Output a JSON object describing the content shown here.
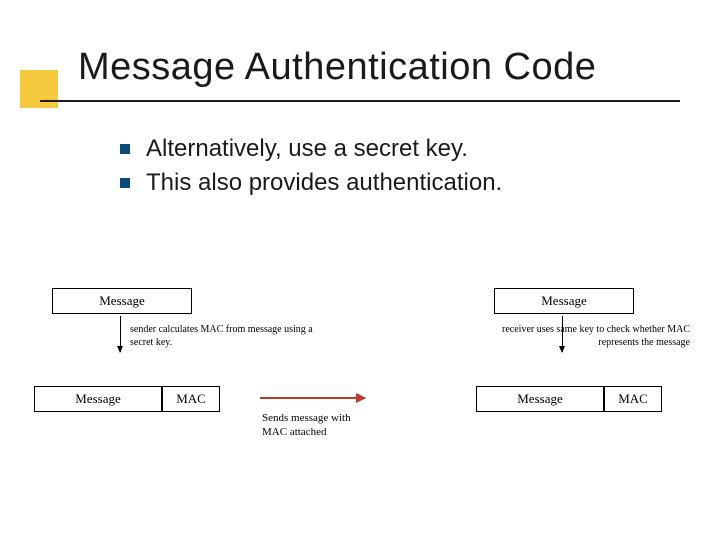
{
  "title": "Message Authentication Code",
  "bullets": [
    "Alternatively, use a secret key.",
    "This also provides authentication."
  ],
  "diagram": {
    "sender_message": "Message",
    "sender_caption": "sender calculates MAC from message using a secret key.",
    "sender_message2": "Message",
    "sender_mac": "MAC",
    "transmit_caption1": "Sends message with",
    "transmit_caption2": "MAC attached",
    "receiver_message": "Message",
    "receiver_caption": "receiver uses same key to check whether MAC represents the message",
    "receiver_message2": "Message",
    "receiver_mac": "MAC"
  }
}
